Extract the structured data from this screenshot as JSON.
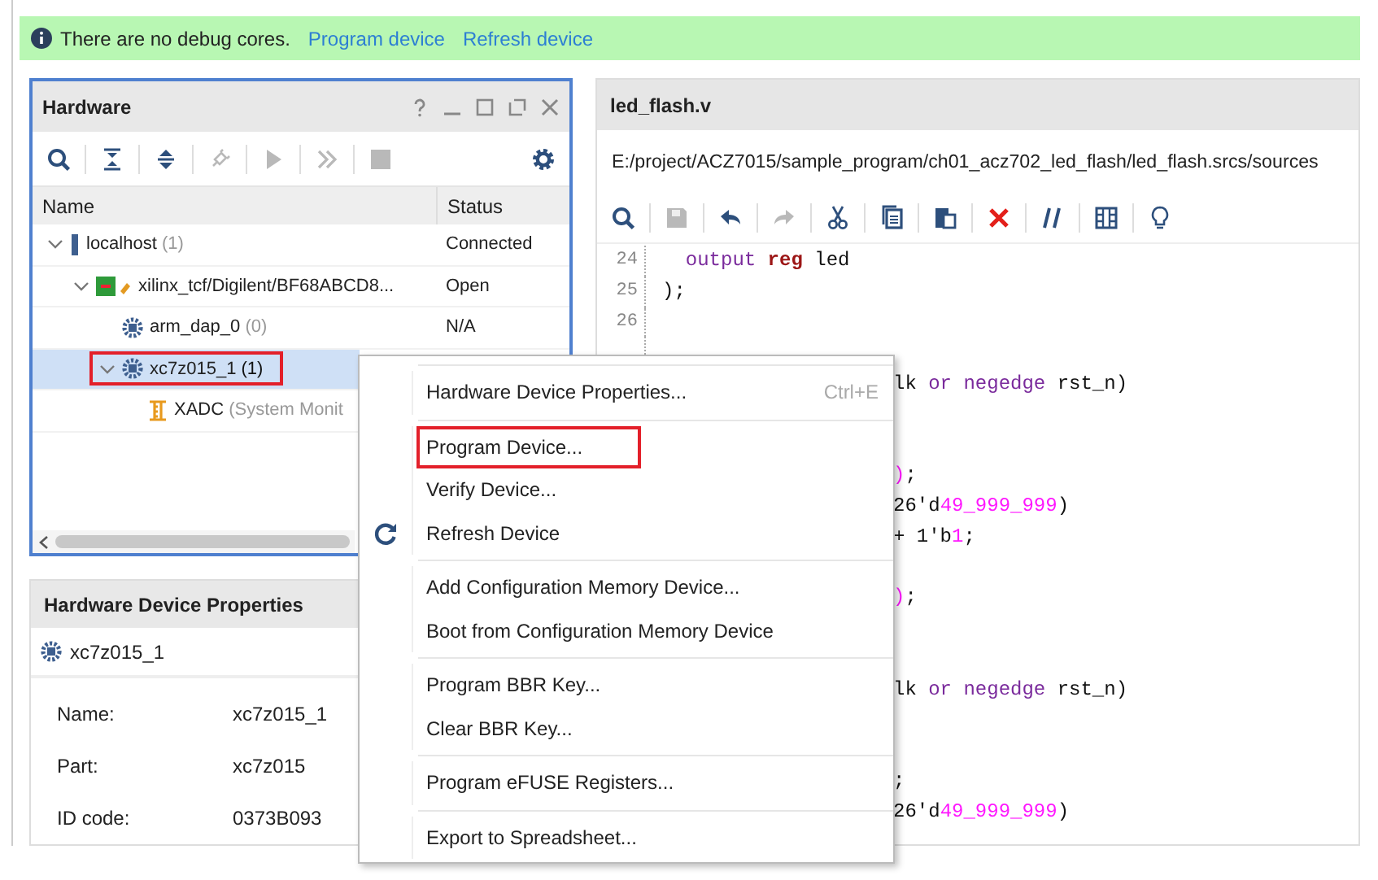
{
  "banner": {
    "message": "There are no debug cores.",
    "links": [
      "Program device",
      "Refresh device"
    ]
  },
  "hardware_panel": {
    "title": "Hardware",
    "toolbar": [
      {
        "kind": "search",
        "disabled": false
      },
      {
        "kind": "collapse",
        "disabled": false
      },
      {
        "kind": "expand",
        "disabled": false
      },
      {
        "kind": "connect",
        "disabled": true
      },
      {
        "kind": "run",
        "disabled": true
      },
      {
        "kind": "step",
        "disabled": true
      },
      {
        "kind": "stop",
        "disabled": true
      },
      {
        "kind": "settings",
        "disabled": false
      }
    ],
    "columns": [
      "Name",
      "Status"
    ],
    "tree": [
      {
        "kind": "host",
        "label": "localhost",
        "note": "(1)",
        "status": "Connected",
        "expanded": true,
        "selected": false,
        "highlighted": false,
        "children": [
          {
            "kind": "board",
            "label": "xilinx_tcf/Digilent/BF68ABCD8...",
            "status": "Open",
            "expanded": true,
            "selected": false,
            "highlighted": false,
            "children": [
              {
                "kind": "chip",
                "label": "arm_dap_0",
                "note": "(0)",
                "status": "N/A",
                "selected": false,
                "highlighted": false
              },
              {
                "kind": "chip",
                "label": "xc7z015_1",
                "note": "(1)",
                "expanded": true,
                "selected": true,
                "highlighted": true,
                "children": [
                  {
                    "kind": "monitor",
                    "label": "XADC",
                    "note": "(System Monit",
                    "selected": false,
                    "highlighted": false
                  }
                ]
              }
            ]
          }
        ]
      }
    ]
  },
  "properties_panel": {
    "title": "Hardware Device Properties",
    "device": "xc7z015_1",
    "fields": [
      {
        "label": "Name:",
        "value": "xc7z015_1"
      },
      {
        "label": "Part:",
        "value": "xc7z015"
      },
      {
        "label": "ID code:",
        "value": "0373B093"
      }
    ]
  },
  "editor": {
    "title": "led_flash.v",
    "path": "E:/project/ACZ7015/sample_program/ch01_acz702_led_flash/led_flash.srcs/sources",
    "toolbar": [
      {
        "kind": "search",
        "disabled": false
      },
      {
        "kind": "save",
        "disabled": true
      },
      {
        "kind": "undo",
        "disabled": false
      },
      {
        "kind": "redo",
        "disabled": true
      },
      {
        "kind": "cut",
        "disabled": false
      },
      {
        "kind": "copy",
        "disabled": false
      },
      {
        "kind": "paste",
        "disabled": false
      },
      {
        "kind": "delete",
        "disabled": false
      },
      {
        "kind": "comment",
        "disabled": false
      },
      {
        "kind": "columns",
        "disabled": false
      },
      {
        "kind": "hint",
        "disabled": false
      }
    ],
    "lines": [
      {
        "kind": "code",
        "number": "24",
        "tokens": [
          {
            "text": "  output",
            "kind": "keyword"
          },
          {
            "text": " reg",
            "kind": "type"
          },
          {
            "text": " led"
          }
        ]
      },
      {
        "kind": "code",
        "number": "25",
        "tokens": [
          {
            "text": ");"
          }
        ]
      },
      {
        "kind": "blank",
        "number": "26"
      },
      {
        "kind": "blank"
      },
      {
        "kind": "code",
        "tokens": [
          {
            "text": "lk "
          },
          {
            "text": "or",
            "kind": "keyword"
          },
          {
            "text": " negedge",
            "kind": "keyword"
          },
          {
            "text": " rst_n)"
          }
        ]
      },
      {
        "kind": "blank"
      },
      {
        "kind": "blank"
      },
      {
        "kind": "code",
        "tokens": [
          {
            "text": ")",
            "kind": "number"
          },
          {
            "text": ";"
          }
        ]
      },
      {
        "kind": "code",
        "tokens": [
          {
            "text": "26'd"
          },
          {
            "text": "49_999_999",
            "kind": "number"
          },
          {
            "text": ")"
          }
        ]
      },
      {
        "kind": "code",
        "tokens": [
          {
            "text": "+ 1'b"
          },
          {
            "text": "1",
            "kind": "number"
          },
          {
            "text": ";"
          }
        ]
      },
      {
        "kind": "blank"
      },
      {
        "kind": "code",
        "tokens": [
          {
            "text": ")",
            "kind": "number"
          },
          {
            "text": ";"
          }
        ]
      },
      {
        "kind": "blank"
      },
      {
        "kind": "blank"
      },
      {
        "kind": "code",
        "tokens": [
          {
            "text": "lk "
          },
          {
            "text": "or",
            "kind": "keyword"
          },
          {
            "text": " negedge",
            "kind": "keyword"
          },
          {
            "text": " rst_n)"
          }
        ]
      },
      {
        "kind": "blank"
      },
      {
        "kind": "blank"
      },
      {
        "kind": "code",
        "tokens": [
          {
            "text": ";"
          }
        ]
      },
      {
        "kind": "code",
        "tokens": [
          {
            "text": "26'd"
          },
          {
            "text": "49_999_999",
            "kind": "number"
          },
          {
            "text": ")"
          }
        ]
      }
    ]
  },
  "context_menu": {
    "groups": [
      [
        {
          "kind": "plain",
          "label": "Hardware Device Properties...",
          "shortcut": "Ctrl+E",
          "highlighted": false
        }
      ],
      [
        {
          "kind": "plain",
          "label": "Program Device...",
          "highlighted": true
        },
        {
          "kind": "plain",
          "label": "Verify Device...",
          "highlighted": false
        },
        {
          "kind": "refresh",
          "label": "Refresh Device",
          "highlighted": false
        }
      ],
      [
        {
          "kind": "plain",
          "label": "Add Configuration Memory Device...",
          "highlighted": false
        },
        {
          "kind": "plain",
          "label": "Boot from Configuration Memory Device",
          "highlighted": false
        }
      ],
      [
        {
          "kind": "plain",
          "label": "Program BBR Key...",
          "highlighted": false
        },
        {
          "kind": "plain",
          "label": "Clear BBR Key...",
          "highlighted": false
        }
      ],
      [
        {
          "kind": "plain",
          "label": "Program eFUSE Registers...",
          "highlighted": false
        }
      ],
      [
        {
          "kind": "plain",
          "label": "Export to Spreadsheet...",
          "highlighted": false
        }
      ]
    ]
  }
}
